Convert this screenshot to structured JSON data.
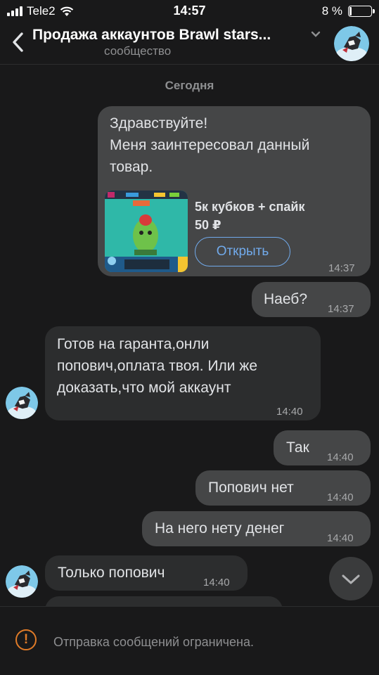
{
  "status": {
    "carrier": "Tele2",
    "time": "14:57",
    "battery": "8 %"
  },
  "header": {
    "title": "Продажа аккаунтов Brawl stars...",
    "subtitle": "сообщество"
  },
  "date_separator": "Сегодня",
  "messages": [
    {
      "direction": "out",
      "lines": [
        "Здравствуйте!",
        "Меня заинтересовал данный",
        "товар."
      ],
      "time": "14:37",
      "product": {
        "title": "5к кубков + спайк",
        "price": "50 ₽",
        "button": "Открыть"
      }
    },
    {
      "direction": "out",
      "text": "Наеб?",
      "time": "14:37"
    },
    {
      "direction": "in",
      "lines": [
        "Готов на гаранта,онли",
        "попович,оплата твоя. Или же",
        "доказать,что мой аккаунт"
      ],
      "time": "14:40"
    },
    {
      "direction": "out",
      "text": "Так",
      "time": "14:40"
    },
    {
      "direction": "out",
      "text": "Попович нет",
      "time": "14:40"
    },
    {
      "direction": "out",
      "text": "На него нету денег",
      "time": "14:40"
    },
    {
      "direction": "in",
      "text": "Только попович",
      "time": "14:40"
    }
  ],
  "composer": {
    "notice": "Отправка сообщений ограничена."
  },
  "colors": {
    "accent": "#71aaeb",
    "warning": "#e07b28",
    "bubble_out": "#454647",
    "bubble_in": "#2c2d2e",
    "background": "#19191a"
  },
  "icons": {
    "back": "chevron-left-icon",
    "dropdown": "chevron-down-icon",
    "scroll": "chevron-down-icon",
    "warning": "exclamation-circle-icon"
  }
}
